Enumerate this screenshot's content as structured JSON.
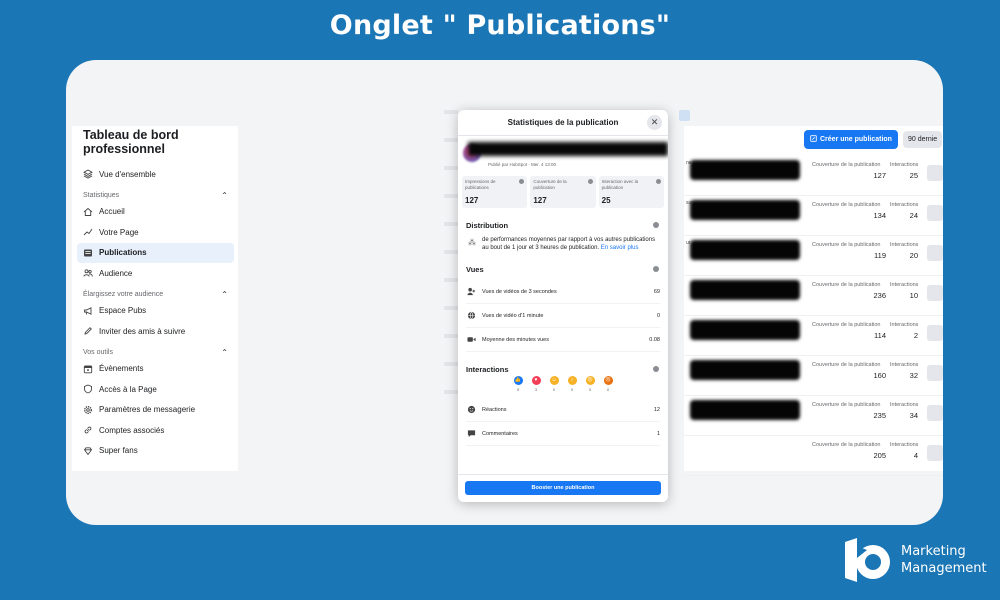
{
  "page_title": "Onglet \" Publications\"",
  "sidebar": {
    "title": "Tableau de bord professionnel",
    "overview": "Vue d'ensemble",
    "sections": [
      {
        "label": "Statistiques",
        "items": [
          "Accueil",
          "Votre Page",
          "Publications",
          "Audience"
        ]
      },
      {
        "label": "Élargissez votre audience",
        "items": [
          "Espace Pubs",
          "Inviter des amis à suivre"
        ]
      },
      {
        "label": "Vos outils",
        "items": [
          "Évènements",
          "Accès à la Page",
          "Paramètres de messagerie",
          "Comptes associés",
          "Super fans"
        ]
      }
    ],
    "active_item": "Publications"
  },
  "table": {
    "create_button": "Créer une publication",
    "range_button": "90 dernie",
    "coverage_label": "Couverture de la publication",
    "interactions_label": "Interactions",
    "rows": [
      {
        "snippet": "ne",
        "coverage": "127",
        "interactions": "25"
      },
      {
        "snippet": "sur",
        "coverage": "134",
        "interactions": "24"
      },
      {
        "snippet": "ur",
        "coverage": "119",
        "interactions": "20"
      },
      {
        "snippet": "",
        "coverage": "236",
        "interactions": "10"
      },
      {
        "snippet": "",
        "coverage": "114",
        "interactions": "2"
      },
      {
        "snippet": "",
        "coverage": "160",
        "interactions": "32"
      },
      {
        "snippet": "",
        "coverage": "235",
        "interactions": "34"
      },
      {
        "snippet": "",
        "coverage": "205",
        "interactions": "4"
      }
    ]
  },
  "modal": {
    "title": "Statistiques de la publication",
    "close": "✕",
    "post_meta": "Publié par HubSpot · Mer. 4 13:00",
    "stats": [
      {
        "label": "Impressions de publications",
        "value": "127"
      },
      {
        "label": "Couverture de la publication",
        "value": "127"
      },
      {
        "label": "Interaction avec la publication",
        "value": "25"
      }
    ],
    "distribution": {
      "heading": "Distribution",
      "text": "de performances moyennes par rapport à vos autres publications au bout de 1 jour et 3 heures de publication.",
      "link": "En savoir plus"
    },
    "views": {
      "heading": "Vues",
      "lines": [
        {
          "label": "Vues de vidéos de 3 secondes",
          "value": "69"
        },
        {
          "label": "Vues de vidéo d'1 minute",
          "value": "0"
        },
        {
          "label": "Moyenne des minutes vues",
          "value": "0.08"
        }
      ]
    },
    "interactions": {
      "heading": "Interactions",
      "reactions": [
        {
          "icon": "like-icon",
          "color": "#1877f2",
          "glyph": "👍",
          "count": "9"
        },
        {
          "icon": "love-icon",
          "color": "#f33e58",
          "glyph": "♥",
          "count": "3"
        },
        {
          "icon": "haha-icon",
          "color": "#f7b125",
          "glyph": "☺",
          "count": "0"
        },
        {
          "icon": "wow-icon",
          "color": "#f7b125",
          "glyph": "○",
          "count": "0"
        },
        {
          "icon": "sad-icon",
          "color": "#f7b125",
          "glyph": "☹",
          "count": "0"
        },
        {
          "icon": "angry-icon",
          "color": "#e9710f",
          "glyph": "☹",
          "count": "0"
        }
      ],
      "lines": [
        {
          "label": "Réactions",
          "value": "12"
        },
        {
          "label": "Commentaires",
          "value": "1"
        }
      ]
    },
    "boost_button": "Booster une publication"
  },
  "brand": {
    "line1": "Marketing",
    "line2": "Management",
    "accent": "#1b76b5"
  }
}
